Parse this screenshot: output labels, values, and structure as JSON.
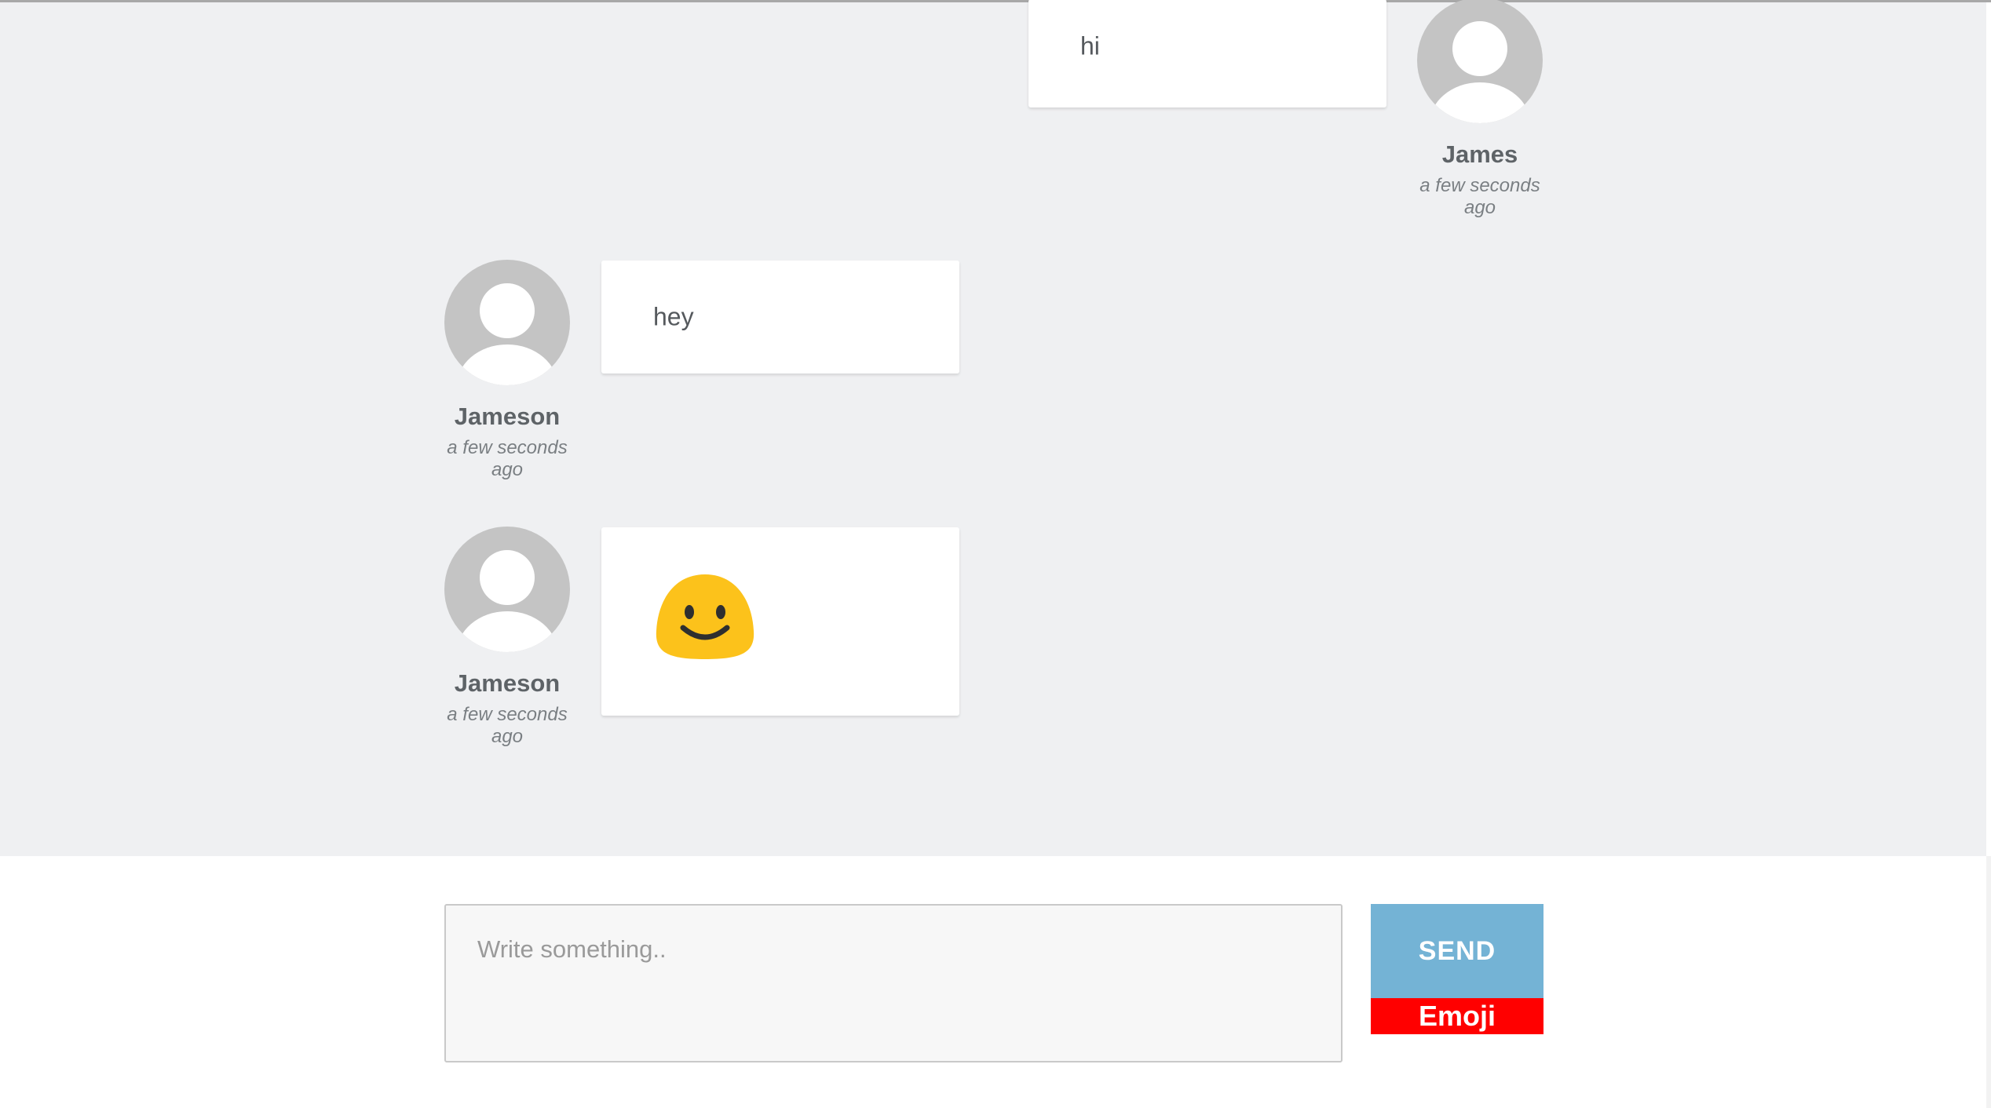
{
  "messages": [
    {
      "user": "James",
      "timestamp": "a few seconds ago",
      "text": "hi",
      "side": "right"
    },
    {
      "user": "Jameson",
      "timestamp": "a few seconds ago",
      "text": "hey",
      "side": "left"
    },
    {
      "user": "Jameson",
      "timestamp": "a few seconds ago",
      "emoji": "smiling-face",
      "side": "left"
    }
  ],
  "composer": {
    "placeholder": "Write something.."
  },
  "buttons": {
    "send_label": "SEND",
    "emoji_label": "Emoji"
  },
  "colors": {
    "chat_background": "#eff0f2",
    "send_button": "#74b3d5",
    "emoji_button": "#ff0000",
    "emoji_face": "#fcc21b"
  }
}
